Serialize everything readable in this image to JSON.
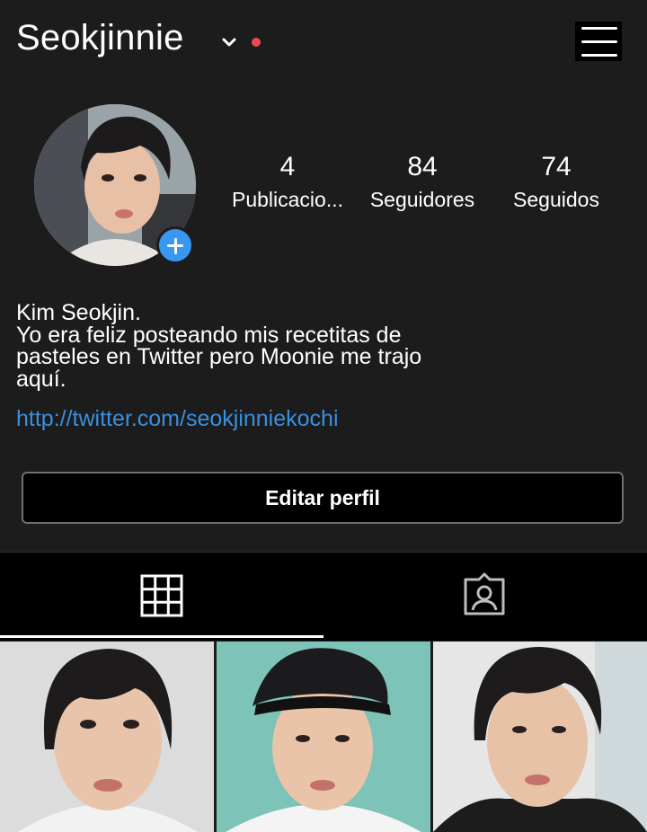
{
  "header": {
    "username": "Seokjinnie",
    "has_notification": true
  },
  "profile": {
    "stats": [
      {
        "value": "4",
        "label": "Publicacio..."
      },
      {
        "value": "84",
        "label": "Seguidores"
      },
      {
        "value": "74",
        "label": "Seguidos"
      }
    ],
    "bio_lines": [
      "Kim Seokjin.",
      "Yo era feliz posteando mis recetitas de",
      "pasteles en Twitter pero Moonie me trajo",
      "aquí."
    ],
    "link": "http://twitter.com/seokjinniekochi",
    "edit_button": "Editar perfil"
  },
  "tabs": [
    {
      "icon": "grid-icon",
      "active": true
    },
    {
      "icon": "tagged-person-icon",
      "active": false
    }
  ],
  "posts": [
    {
      "icon": "photo-thumbnail"
    },
    {
      "icon": "photo-thumbnail"
    },
    {
      "icon": "photo-thumbnail"
    }
  ],
  "colors": {
    "background": "#1c1c1c",
    "link": "#3a8fe0",
    "add_button": "#3897f0",
    "notification_dot": "#ed4956"
  }
}
